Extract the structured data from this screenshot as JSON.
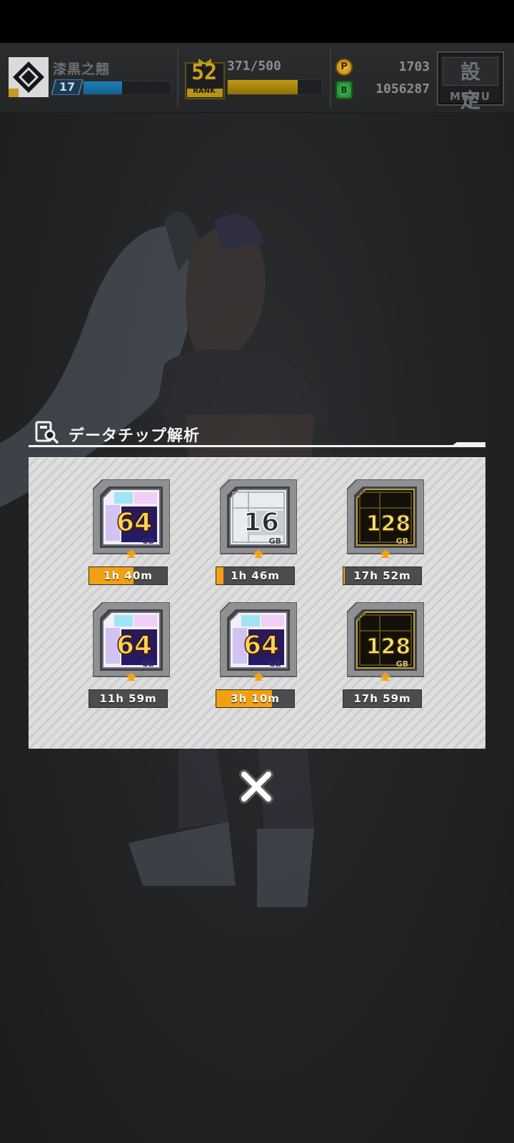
{
  "hud": {
    "player_name": "漆黒之翹",
    "level": "17",
    "xp_fraction": 0.44,
    "rank_number": "52",
    "rank_label": "RANK",
    "stamina": "371/500",
    "stamina_fraction": 0.742,
    "coins": "1703",
    "money": "1056287",
    "coin_glyph": "P",
    "money_glyph": "B",
    "menu_kanji": "設定",
    "menu_label": "MENU"
  },
  "dialog": {
    "title": "データチップ解析",
    "chips": [
      {
        "capacity": "64",
        "unit": "GB",
        "tier": "iridescent",
        "timer": "1h 40m",
        "progress": 0.57
      },
      {
        "capacity": "16",
        "unit": "GB",
        "tier": "silver",
        "timer": "1h 46m",
        "progress": 0.09
      },
      {
        "capacity": "128",
        "unit": "GB",
        "tier": "gold",
        "timer": "17h 52m",
        "progress": 0.02
      },
      {
        "capacity": "64",
        "unit": "GB",
        "tier": "iridescent",
        "timer": "11h 59m",
        "progress": 0.0
      },
      {
        "capacity": "64",
        "unit": "GB",
        "tier": "iridescent",
        "timer": "3h 10m",
        "progress": 0.72
      },
      {
        "capacity": "128",
        "unit": "GB",
        "tier": "gold",
        "timer": "17h 59m",
        "progress": 0.0
      }
    ]
  },
  "icons": {
    "player_emblem": "diamond-emblem-icon",
    "rank": "rank-badge-icon",
    "coin": "coin-icon",
    "money": "money-icon",
    "title": "data-scan-icon",
    "close": "close-x-icon"
  },
  "colors": {
    "accent_orange": "#f2a012",
    "xp_blue": "#1f7fb7",
    "stamina_gold": "#c29a14"
  }
}
